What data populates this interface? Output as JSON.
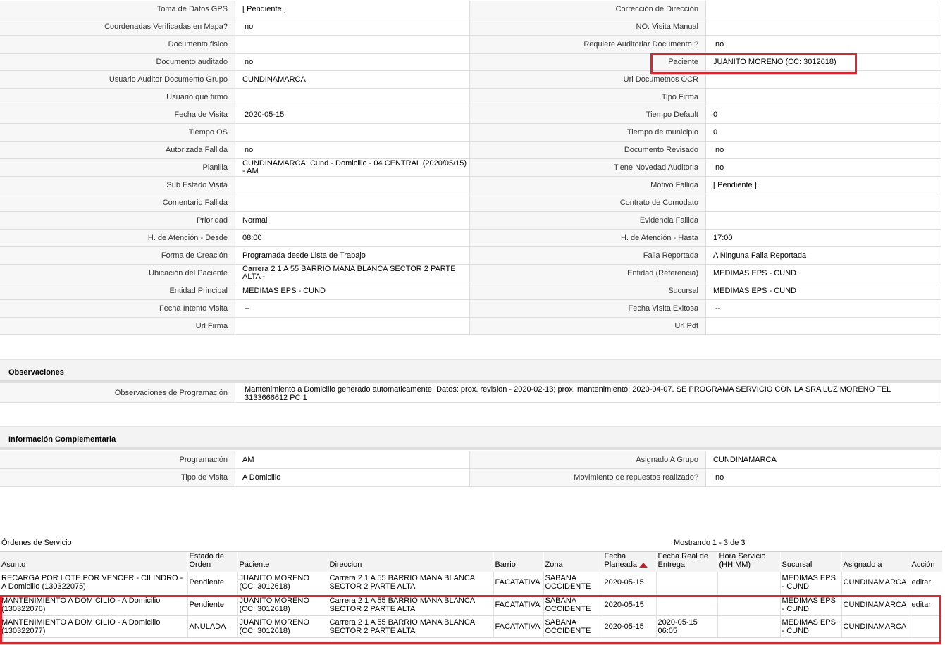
{
  "detail_rows": [
    {
      "l1": "Toma de Datos GPS",
      "v1": "[ Pendiente ]",
      "l2": "Corrección de Dirección",
      "v2": ""
    },
    {
      "l1": "Coordenadas Verificadas en Mapa?",
      "v1": "no",
      "l2": "NO. Visita Manual",
      "v2": ""
    },
    {
      "l1": "Documento fisico",
      "v1": "",
      "l2": "Requiere Auditoriar Documento ?",
      "v2": "no"
    },
    {
      "l1": "Documento auditado",
      "v1": "no",
      "l2": "Paciente",
      "v2": "JUANITO MORENO (CC: 3012618)"
    },
    {
      "l1": "Usuario Auditor Documento Grupo",
      "v1": "CUNDINAMARCA",
      "l2": "Url Documetnos OCR",
      "v2": ""
    },
    {
      "l1": "Usuario que firmo",
      "v1": "",
      "l2": "Tipo Firma",
      "v2": ""
    },
    {
      "l1": "Fecha de Visita",
      "v1": "2020-05-15",
      "l2": "Tiempo Default",
      "v2": "0"
    },
    {
      "l1": "Tiempo OS",
      "v1": "",
      "l2": "Tiempo de municipio",
      "v2": "0"
    },
    {
      "l1": "Autorizada Fallida",
      "v1": "no",
      "l2": "Documento Revisado",
      "v2": "no"
    },
    {
      "l1": "Planilla",
      "v1": "CUNDINAMARCA: Cund - Domicilio - 04 CENTRAL (2020/05/15) - AM",
      "l2": "Tiene Novedad Auditoria",
      "v2": "no"
    },
    {
      "l1": "Sub Estado Visita",
      "v1": "",
      "l2": "Motivo Fallida",
      "v2": "[ Pendiente ]"
    },
    {
      "l1": "Comentario Fallida",
      "v1": "",
      "l2": "Contrato de Comodato",
      "v2": ""
    },
    {
      "l1": "Prioridad",
      "v1": "Normal",
      "l2": "Evidencia Fallida",
      "v2": ""
    },
    {
      "l1": "H. de Atención - Desde",
      "v1": "08:00",
      "l2": "H. de Atención - Hasta",
      "v2": "17:00"
    },
    {
      "l1": "Forma de Creación",
      "v1": "Programada desde Lista de Trabajo",
      "l2": "Falla Reportada",
      "v2": "A Ninguna Falla Reportada"
    },
    {
      "l1": "Ubicación del Paciente",
      "v1": "Carrera 2 1 A 55 BARRIO MANA BLANCA SECTOR 2 PARTE ALTA -",
      "l2": "Entidad (Referencia)",
      "v2": "MEDIMAS EPS - CUND"
    },
    {
      "l1": "Entidad Principal",
      "v1": "MEDIMAS EPS - CUND",
      "l2": "Sucursal",
      "v2": "MEDIMAS EPS - CUND"
    },
    {
      "l1": "Fecha Intento Visita",
      "v1": "--",
      "l2": "Fecha Visita Exitosa",
      "v2": "--"
    },
    {
      "l1": "Url Firma",
      "v1": "",
      "l2": "Url Pdf",
      "v2": ""
    }
  ],
  "observaciones": {
    "title": "Observaciones",
    "label": "Observaciones de Programación",
    "value": "Mantenimiento a Domicilio generado automaticamente. Datos: prox. revision - 2020-02-13; prox. mantenimiento: 2020-04-07. SE PROGRAMA SERVICIO CON LA SRA LUZ MORENO TEL 3133666612 PC 1"
  },
  "info": {
    "title": "Información Complementaria",
    "rows": [
      {
        "l1": "Programación",
        "v1": "AM",
        "l2": "Asignado A Grupo",
        "v2": "CUNDINAMARCA"
      },
      {
        "l1": "Tipo de Visita",
        "v1": "A Domicilio",
        "l2": "Movimiento de repuestos realizado?",
        "v2": "no"
      }
    ]
  },
  "orders": {
    "title": "Órdenes de Servicio",
    "count": "Mostrando 1 - 3 de 3",
    "columns": [
      "Asunto",
      "Estado de Orden",
      "Paciente",
      "Direccion",
      "Barrio",
      "Zona",
      "Fecha Planeada",
      "Fecha Real de Entrega",
      "Hora Servicio (HH:MM)",
      "Sucursal",
      "Asignado a",
      "Acción"
    ],
    "rows": [
      [
        "RECARGA POR LOTE POR VENCER - CILINDRO - A Domicilio (130322075)",
        "Pendiente",
        "JUANITO MORENO (CC: 3012618)",
        "Carrera 2 1 A 55 BARRIO MANA BLANCA SECTOR 2 PARTE ALTA",
        "FACATATIVA",
        "SABANA OCCIDENTE",
        "2020-05-15",
        "",
        "",
        "MEDIMAS EPS - CUND",
        "CUNDINAMARCA",
        "editar"
      ],
      [
        "MANTENIMIENTO A DOMICILIO - A Domicilio (130322076)",
        "Pendiente",
        "JUANITO MORENO (CC: 3012618)",
        "Carrera 2 1 A 55 BARRIO MANA BLANCA SECTOR 2 PARTE ALTA",
        "FACATATIVA",
        "SABANA OCCIDENTE",
        "2020-05-15",
        "",
        "",
        "MEDIMAS EPS - CUND",
        "CUNDINAMARCA",
        "editar"
      ],
      [
        "MANTENIMIENTO A DOMICILIO - A Domicilio (130322077)",
        "ANULADA",
        "JUANITO MORENO (CC: 3012618)",
        "Carrera 2 1 A 55 BARRIO MANA BLANCA SECTOR 2 PARTE ALTA",
        "FACATATIVA",
        "SABANA OCCIDENTE",
        "2020-05-15",
        "2020-05-15 06:05",
        "",
        "MEDIMAS EPS - CUND",
        "CUNDINAMARCA",
        ""
      ]
    ]
  },
  "colors": {
    "highlight": "#e8202a",
    "sort_arrow": "#cc2222",
    "label_bg": "#f7f7f7"
  }
}
